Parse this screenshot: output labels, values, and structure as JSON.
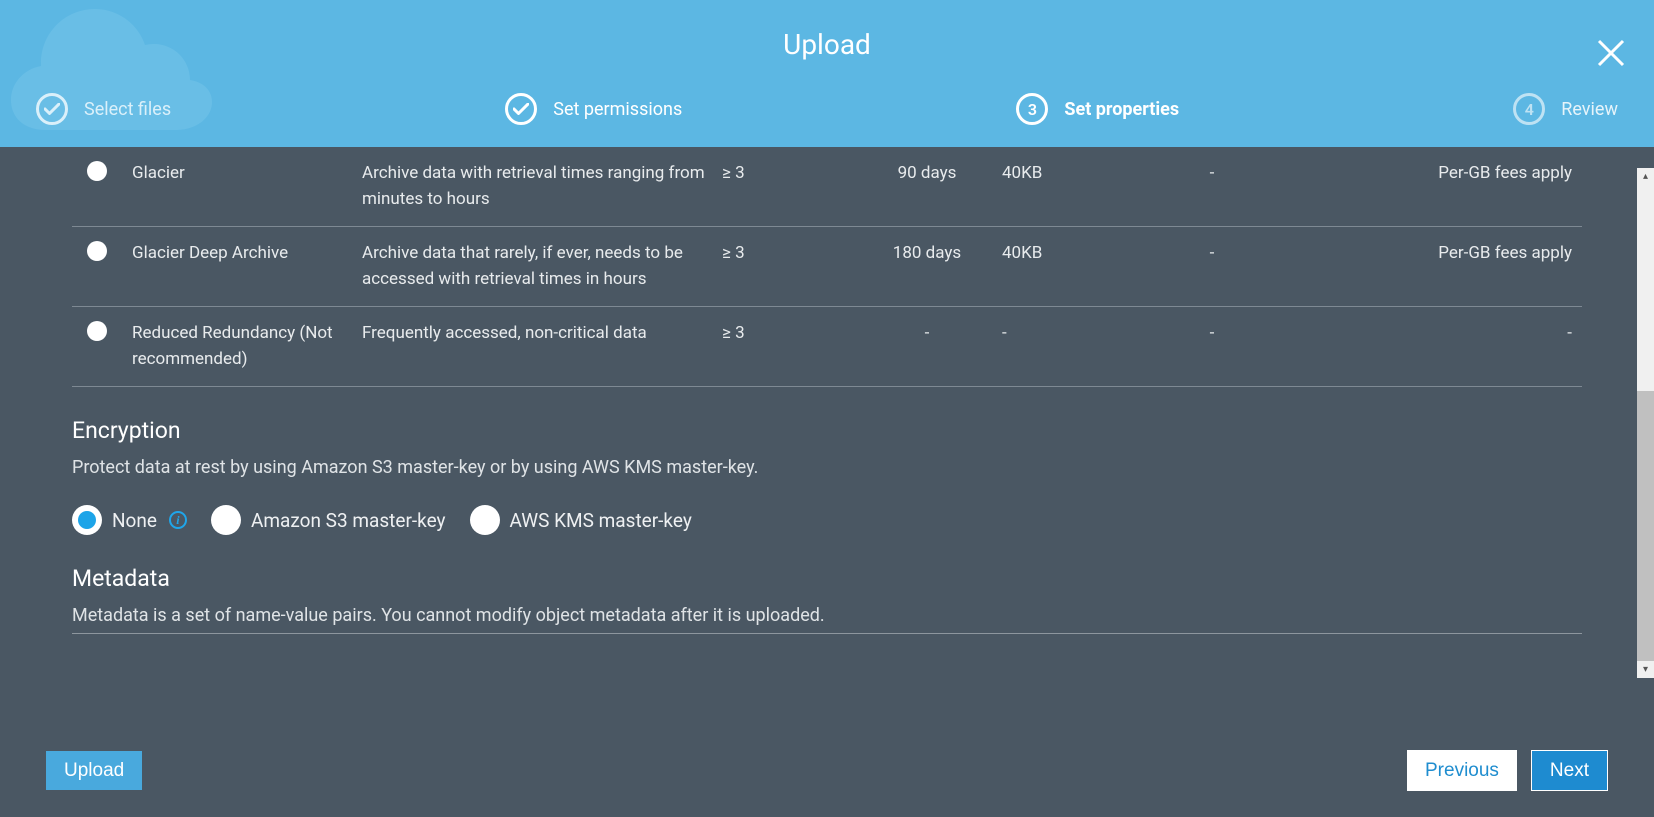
{
  "title": "Upload",
  "steps": [
    {
      "label": "Select files",
      "state": "done"
    },
    {
      "label": "Set permissions",
      "state": "done"
    },
    {
      "label": "Set properties",
      "state": "active",
      "number": "3"
    },
    {
      "label": "Review",
      "state": "pending",
      "number": "4"
    }
  ],
  "storage_rows": [
    {
      "name": "Glacier",
      "description": "Archive data with retrieval times ranging from minutes to hours",
      "zones": "≥ 3",
      "min_duration": "90 days",
      "min_size": "40KB",
      "monitoring": "-",
      "retrieval": "Per-GB fees apply"
    },
    {
      "name": "Glacier Deep Archive",
      "description": "Archive data that rarely, if ever, needs to be accessed with retrieval times in hours",
      "zones": "≥ 3",
      "min_duration": "180 days",
      "min_size": "40KB",
      "monitoring": "-",
      "retrieval": "Per-GB fees apply"
    },
    {
      "name": "Reduced Redundancy (Not recommended)",
      "description": "Frequently accessed, non-critical data",
      "zones": "≥ 3",
      "min_duration": "-",
      "min_size": "-",
      "monitoring": "-",
      "retrieval": "-"
    }
  ],
  "encryption": {
    "title": "Encryption",
    "text": "Protect data at rest by using Amazon S3 master-key or by using AWS KMS master-key.",
    "options": [
      {
        "label": "None",
        "selected": true,
        "info": true
      },
      {
        "label": "Amazon S3 master-key",
        "selected": false
      },
      {
        "label": "AWS KMS master-key",
        "selected": false
      }
    ]
  },
  "metadata": {
    "title": "Metadata",
    "text": "Metadata is a set of name-value pairs. You cannot modify object metadata after it is uploaded."
  },
  "buttons": {
    "upload": "Upload",
    "previous": "Previous",
    "next": "Next"
  }
}
